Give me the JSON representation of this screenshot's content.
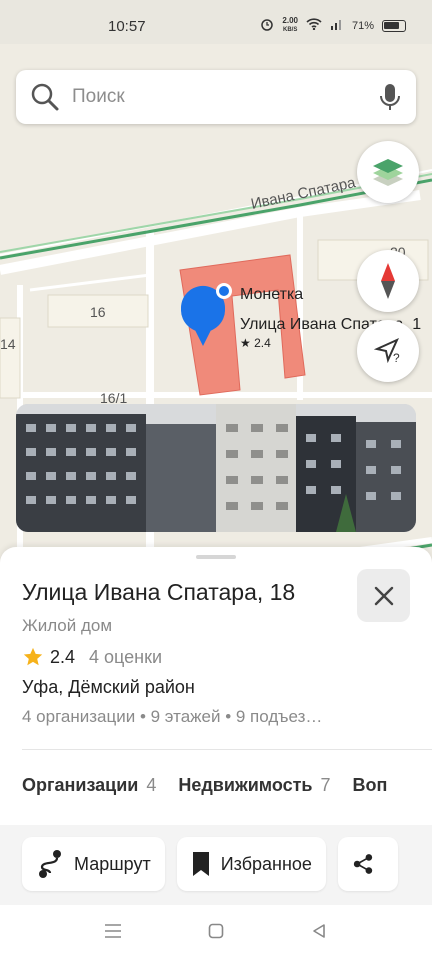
{
  "status_bar": {
    "time": "10:57",
    "speed_value": "2.00",
    "speed_unit": "KB/S",
    "battery": "71%"
  },
  "search": {
    "placeholder": "Поиск"
  },
  "map": {
    "street_label": "Ивана Спатара",
    "building_numbers": [
      "20",
      "16",
      "14",
      "16/1"
    ],
    "poi": {
      "name": "Монетка",
      "address": "Улица Ивана Спатара, 1",
      "rating": "★ 2.4"
    }
  },
  "place": {
    "title": "Улица Ивана Спатара, 18",
    "type": "Жилой дом",
    "rating": "2.4",
    "rating_count": "4 оценки",
    "location": "Уфа, Дёмский район",
    "details": "4 организации • 9 этажей • 9 подъез…"
  },
  "tabs": [
    {
      "label": "Организации",
      "count": "4"
    },
    {
      "label": "Недвижимость",
      "count": "7"
    },
    {
      "label": "Воп",
      "count": ""
    }
  ],
  "actions": [
    {
      "label": "Маршрут",
      "icon": "route-icon"
    },
    {
      "label": "Избранное",
      "icon": "bookmark-icon"
    },
    {
      "label": "",
      "icon": "share-icon"
    }
  ],
  "colors": {
    "accent_blue": "#1a73e8",
    "building_red": "#f08a7a",
    "road_green": "#4aa36a",
    "star": "#f6b21b"
  }
}
